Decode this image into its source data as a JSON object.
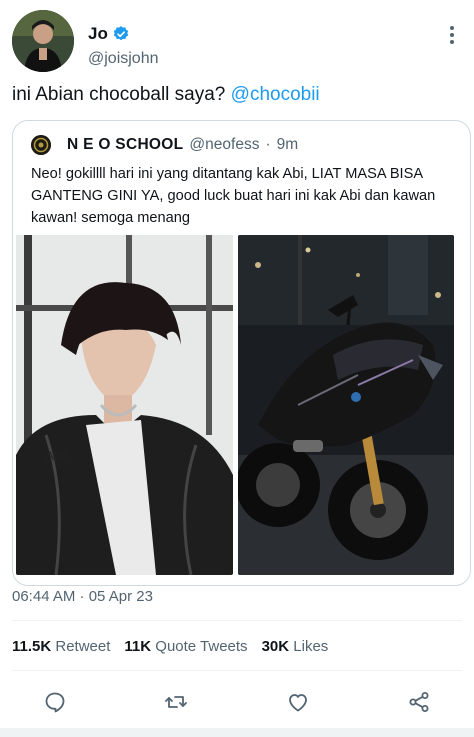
{
  "author": {
    "name": "Jo",
    "handle": "@joisjohn",
    "verified": true
  },
  "tweet": {
    "text": "ini Abian chocoball saya?",
    "mention": "@chocobii"
  },
  "quoted": {
    "name": "N E O SCHOOL",
    "handle": "@neofess",
    "separator": "·",
    "time": "9m",
    "text": "Neo! gokillll hari ini yang ditantang kak Abi, LIAT MASA BISA GANTENG GINI YA, good luck buat hari ini kak Abi dan kawan kawan! semoga menang"
  },
  "timestamp": "06:44 AM · 05 Apr 23",
  "stats": {
    "retweets_count": "11.5K",
    "retweets_label": "Retweet",
    "quotes_count": "11K",
    "quotes_label": "Quote Tweets",
    "likes_count": "30K",
    "likes_label": "Likes"
  },
  "actions": [
    "reply-icon",
    "retweet-icon",
    "like-icon",
    "share-icon"
  ],
  "colors": {
    "accent": "#1d9bf0",
    "text": "#0f1419",
    "secondary": "#536471",
    "border": "#cfd9de"
  }
}
